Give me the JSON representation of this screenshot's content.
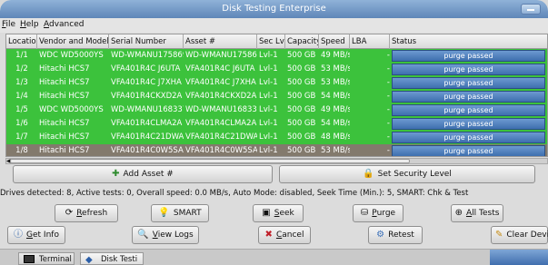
{
  "window": {
    "title": "Disk Testing Enterprise"
  },
  "menu": [
    {
      "key": "F",
      "rest": "ile"
    },
    {
      "key": "H",
      "rest": "elp"
    },
    {
      "key": "A",
      "rest": "dvanced"
    }
  ],
  "table": {
    "columns": [
      "Location",
      "Vendor and Model",
      "Serial Number",
      "Asset #",
      "Sec Lvl",
      "Capacity",
      "Speed",
      "LBA",
      "Status"
    ],
    "rows": [
      [
        "1/1",
        "WDC WD5000YS",
        "WD-WMANU1758699",
        "WD-WMANU1758699",
        "Lvl-1",
        "500 GB",
        "49 MB/s",
        "-",
        "purge passed"
      ],
      [
        "1/2",
        "Hitachi HCS7",
        "VFA401R4C J6UTA",
        "VFA401R4C J6UTA",
        "Lvl-1",
        "500 GB",
        "53 MB/s",
        "-",
        "purge passed"
      ],
      [
        "1/3",
        "Hitachi HCS7",
        "VFA401R4C J7XHA",
        "VFA401R4C J7XHA",
        "Lvl-1",
        "500 GB",
        "53 MB/s",
        "-",
        "purge passed"
      ],
      [
        "1/4",
        "Hitachi HCS7",
        "VFA401R4CKXD2A",
        "VFA401R4CKXD2A",
        "Lvl-1",
        "500 GB",
        "54 MB/s",
        "-",
        "purge passed"
      ],
      [
        "1/5",
        "WDC WD5000YS",
        "WD-WMANU1683379",
        "WD-WMANU1683379",
        "Lvl-1",
        "500 GB",
        "49 MB/s",
        "-",
        "purge passed"
      ],
      [
        "1/6",
        "Hitachi HCS7",
        "VFA401R4CLMA2A",
        "VFA401R4CLMA2A",
        "Lvl-1",
        "500 GB",
        "54 MB/s",
        "-",
        "purge passed"
      ],
      [
        "1/7",
        "Hitachi HCS7",
        "VFA401R4C21DWA",
        "VFA401R4C21DWA",
        "Lvl-1",
        "500 GB",
        "48 MB/s",
        "-",
        "purge passed"
      ],
      [
        "1/8",
        "Hitachi HCS7",
        "VFA401R4C0W5SA",
        "VFA401R4C0W5SA",
        "Lvl-1",
        "500 GB",
        "53 MB/s",
        "-",
        "purge passed"
      ]
    ],
    "selected_row": 7
  },
  "buttons": {
    "add_asset": "Add Asset #",
    "set_security": "Set Security Level",
    "refresh_key": "R",
    "refresh_rest": "efresh",
    "smart": "SMART",
    "seek_key": "S",
    "seek_rest": "eek",
    "purge_key": "P",
    "purge_rest": "urge",
    "all_tests_key": "A",
    "all_tests_rest": "ll Tests",
    "get_info_key": "G",
    "get_info_rest": "et Info",
    "view_logs_key": "V",
    "view_logs_rest": "iew Logs",
    "cancel_key": "C",
    "cancel_rest": "ancel",
    "retest": "Retest",
    "clear_device": "Clear Device"
  },
  "info_line": "Drives detected: 8,   Active tests: 0,   Overall speed: 0.0 MB/s,   Auto Mode: disabled,   Seek Time (Min.): 5,   SMART: Chk & Test",
  "taskbar": {
    "items": [
      "Terminal",
      "Disk Testi"
    ]
  },
  "colors": {
    "row_green": "#3cc23c",
    "row_selected": "#837a6d",
    "status_bar": "#4f80bf",
    "titlebar": "#6f95c4"
  },
  "icons": [
    "plus-icon",
    "lock-icon",
    "refresh-icon",
    "bulb-icon",
    "seek-icon",
    "purge-icon",
    "all-tests-icon",
    "info-icon",
    "view-logs-icon",
    "cancel-icon",
    "retest-icon",
    "clear-device-icon",
    "terminal-icon",
    "app-icon"
  ]
}
